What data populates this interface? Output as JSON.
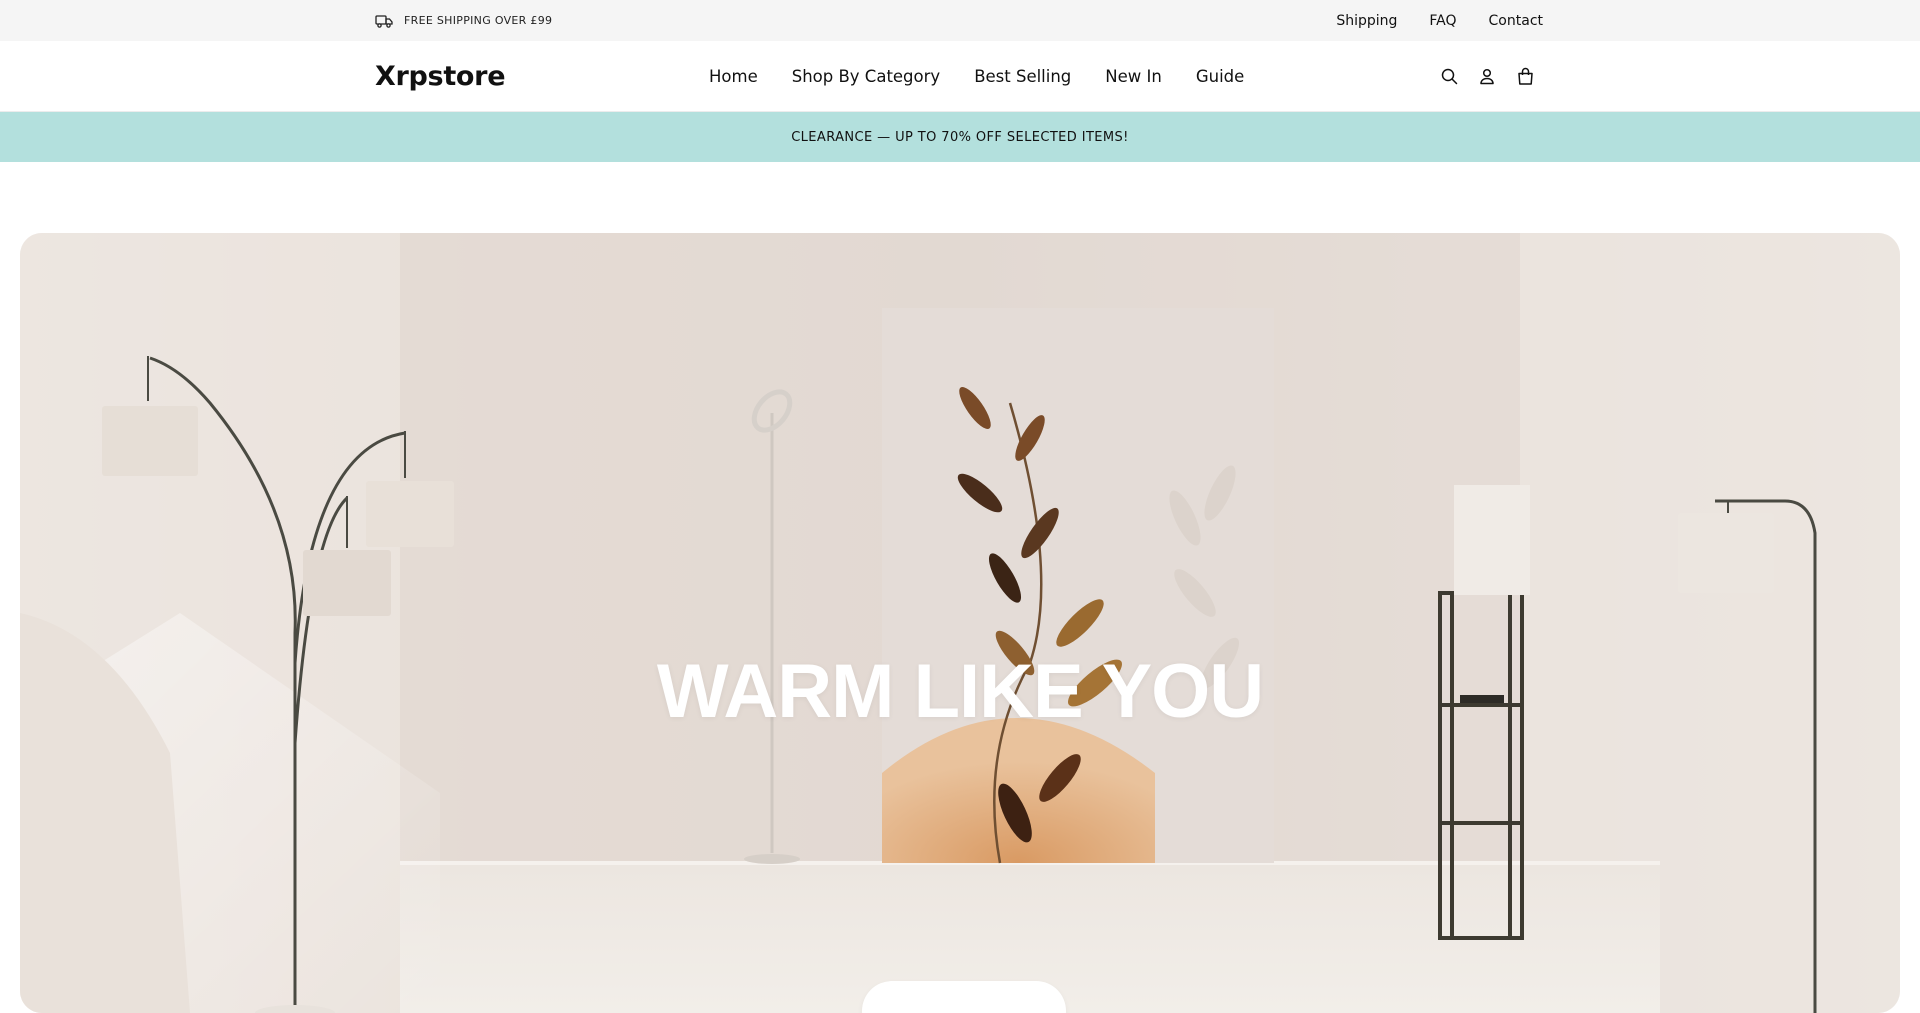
{
  "topbar": {
    "shipping_text": "FREE SHIPPING OVER £99",
    "shipping_icon": "truck-icon",
    "links": [
      "Shipping",
      "FAQ",
      "Contact"
    ]
  },
  "header": {
    "logo": "Xrpstore",
    "nav": [
      "Home",
      "Shop By Category",
      "Best Selling",
      "New In",
      "Guide"
    ],
    "icons": [
      "search-icon",
      "account-icon",
      "cart-icon"
    ]
  },
  "announcement": {
    "text": "CLEARANCE — UP TO 70% OFF SELECTED ITEMS!",
    "background": "#b3e0dd"
  },
  "hero": {
    "title": "WARM LIKE YOU",
    "background": "#e6ddd6"
  }
}
